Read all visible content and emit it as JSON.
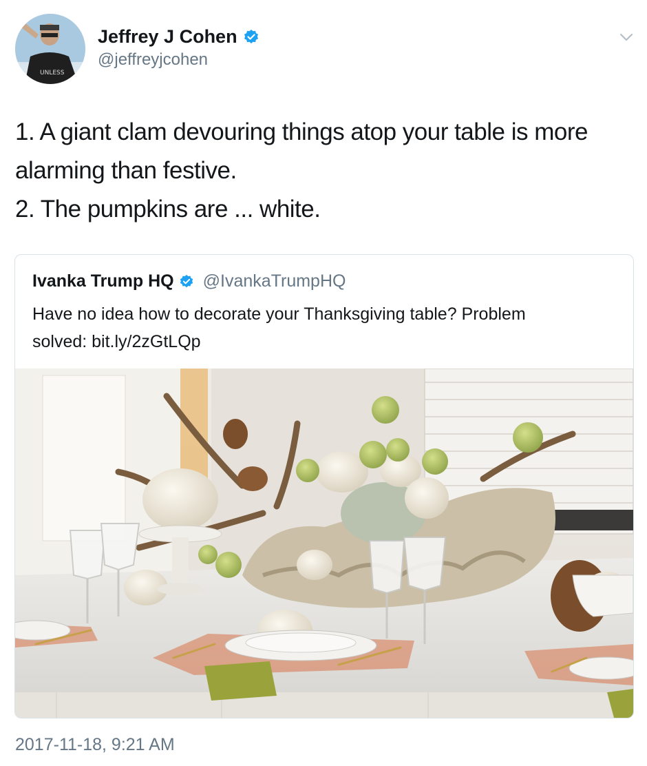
{
  "tweet": {
    "author_name": "Jeffrey J Cohen",
    "author_handle": "@jeffreyjcohen",
    "verified": true,
    "text_lines": [
      "1. A giant clam devouring things atop your table is more",
      "alarming than festive.",
      "2. The pumpkins are ... white."
    ],
    "timestamp": "2017-11-18, 9:21 AM",
    "avatar_shirt_text": "UNLESS"
  },
  "quoted_tweet": {
    "author_name": "Ivanka Trump HQ",
    "author_handle": "@IvankaTrumpHQ",
    "verified": true,
    "text_lines": [
      "Have no idea how to decorate your Thanksgiving table? Problem",
      "solved: bit.ly/2zGtLQp"
    ]
  },
  "colors": {
    "verified_blue": "#1da1f2",
    "secondary_text": "#657786",
    "border": "#d9e1e8"
  },
  "icons": {
    "verified": "verified-badge-icon",
    "menu": "chevron-down-icon"
  }
}
